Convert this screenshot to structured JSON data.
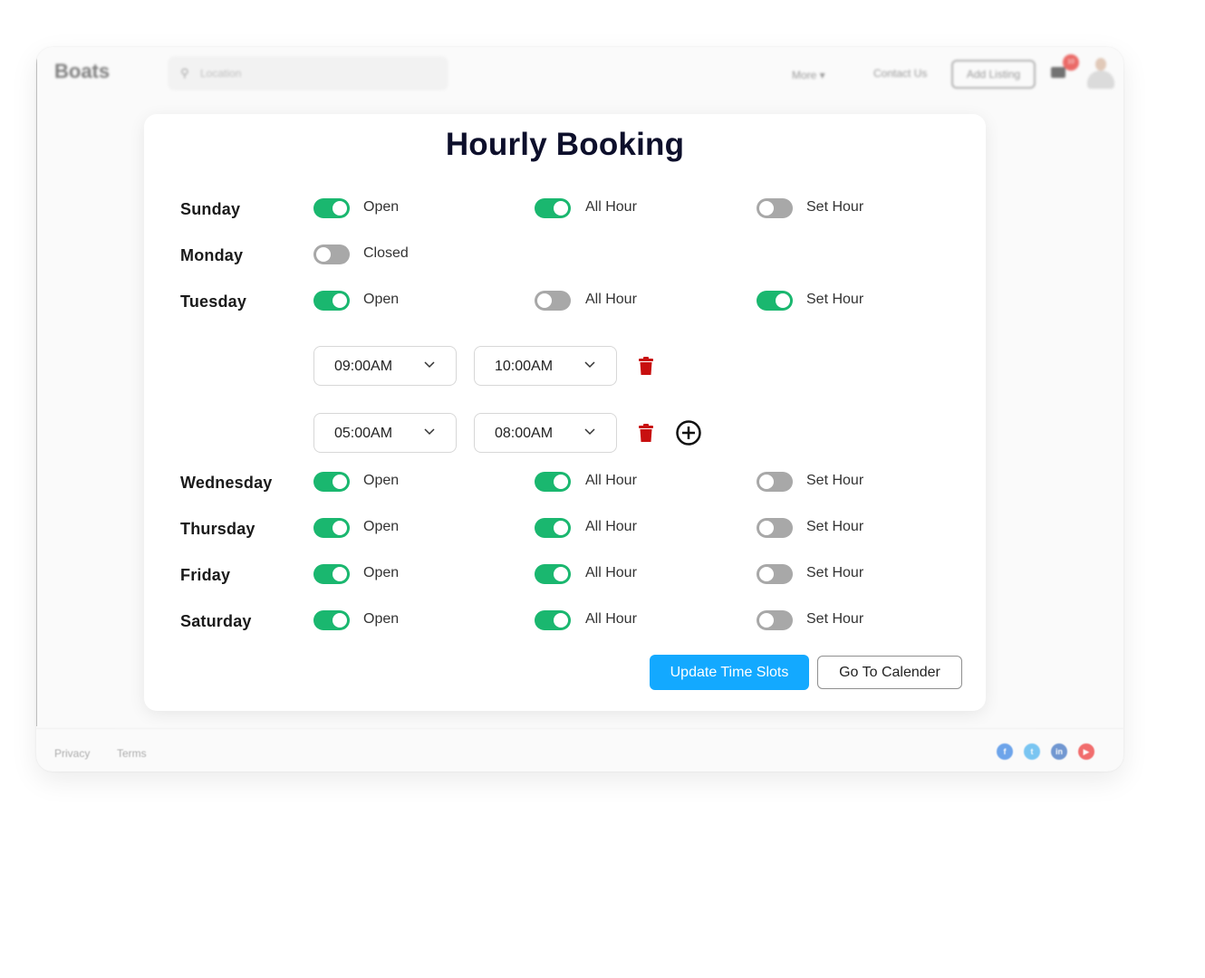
{
  "header": {
    "brand": "Boats",
    "search_placeholder": "Location",
    "nav_more": "More ▾",
    "nav_contact": "Contact Us",
    "add_listing": "Add Listing",
    "notification_count": "10"
  },
  "page": {
    "title": "Hourly Booking"
  },
  "days": [
    {
      "name": "Sunday",
      "open": true,
      "status_label": "Open",
      "all_hour": true,
      "all_hour_label": "All Hour",
      "set_hour": false,
      "set_hour_label": "Set Hour"
    },
    {
      "name": "Monday",
      "open": false,
      "status_label": "Closed"
    },
    {
      "name": "Tuesday",
      "open": true,
      "status_label": "Open",
      "all_hour": false,
      "all_hour_label": "All Hour",
      "set_hour": true,
      "set_hour_label": "Set Hour",
      "slots": [
        {
          "from": "09:00AM",
          "to": "10:00AM"
        },
        {
          "from": "05:00AM",
          "to": "08:00AM"
        }
      ]
    },
    {
      "name": "Wednesday",
      "open": true,
      "status_label": "Open",
      "all_hour": true,
      "all_hour_label": "All Hour",
      "set_hour": false,
      "set_hour_label": "Set Hour"
    },
    {
      "name": "Thursday",
      "open": true,
      "status_label": "Open",
      "all_hour": true,
      "all_hour_label": "All Hour",
      "set_hour": false,
      "set_hour_label": "Set Hour"
    },
    {
      "name": "Friday",
      "open": true,
      "status_label": "Open",
      "all_hour": true,
      "all_hour_label": "All Hour",
      "set_hour": false,
      "set_hour_label": "Set Hour"
    },
    {
      "name": "Saturday",
      "open": true,
      "status_label": "Open",
      "all_hour": true,
      "all_hour_label": "All Hour",
      "set_hour": false,
      "set_hour_label": "Set Hour"
    }
  ],
  "actions": {
    "update": "Update Time Slots",
    "calendar": "Go To Calender"
  },
  "footer": {
    "privacy": "Privacy",
    "terms": "Terms",
    "social": [
      {
        "name": "facebook",
        "glyph": "f",
        "color": "#4a8fe7"
      },
      {
        "name": "twitter",
        "glyph": "t",
        "color": "#5ab8f0"
      },
      {
        "name": "linkedin",
        "glyph": "in",
        "color": "#4f7fc7"
      },
      {
        "name": "youtube",
        "glyph": "▶",
        "color": "#ef4a4a"
      }
    ]
  },
  "colors": {
    "toggle_on": "#1ab76f",
    "toggle_off": "#a8a8a8",
    "primary": "#13a9ff",
    "delete": "#c80f0f"
  }
}
